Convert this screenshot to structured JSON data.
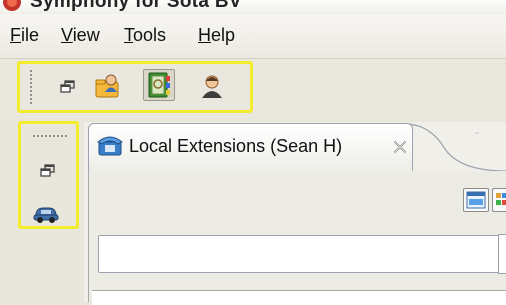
{
  "window": {
    "title": "Symphony for Sota BV",
    "colors": {
      "highlight": "#f2ec2a",
      "chrome": "#e9e6dc"
    }
  },
  "menubar": {
    "items": [
      {
        "label": "File",
        "mnemonic": "F",
        "rest": "ile"
      },
      {
        "label": "View",
        "mnemonic": "V",
        "rest": "iew"
      },
      {
        "label": "Tools",
        "mnemonic": "T",
        "rest": "ools"
      },
      {
        "label": "Help",
        "mnemonic": "H",
        "rest": "elp"
      }
    ]
  },
  "toolbar": {
    "buttons": [
      {
        "icon": "restore-window-icon"
      },
      {
        "icon": "user-folder-icon"
      },
      {
        "icon": "address-book-icon",
        "pressed": true
      },
      {
        "icon": "person-icon"
      }
    ]
  },
  "side_toolbar": {
    "buttons": [
      {
        "icon": "restore-window-icon"
      },
      {
        "icon": "car-icon"
      }
    ]
  },
  "view": {
    "tab": {
      "label": "Local Extensions (Sean H)",
      "icon": "phone-icon",
      "close_icon": "close-icon"
    },
    "view_toggle_icons": [
      "list-view-icon",
      "grid-view-icon"
    ],
    "search": {
      "value": "",
      "placeholder": ""
    }
  }
}
